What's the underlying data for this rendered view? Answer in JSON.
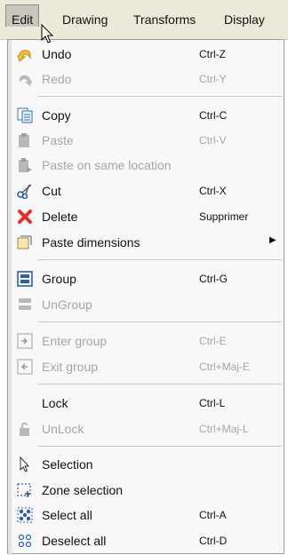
{
  "menubar": {
    "edit": "Edit",
    "drawing": "Drawing",
    "transforms": "Transforms",
    "display": "Display"
  },
  "menu": {
    "undo": {
      "label": "Undo",
      "shortcut": "Ctrl-Z"
    },
    "redo": {
      "label": "Redo",
      "shortcut": "Ctrl-Y"
    },
    "copy": {
      "label": "Copy",
      "shortcut": "Ctrl-C"
    },
    "paste": {
      "label": "Paste",
      "shortcut": "Ctrl-V"
    },
    "paste_same": {
      "label": "Paste on same location"
    },
    "cut": {
      "label": "Cut",
      "shortcut": "Ctrl-X"
    },
    "delete": {
      "label": "Delete",
      "shortcut": "Supprimer"
    },
    "paste_dimensions": {
      "label": "Paste dimensions"
    },
    "group": {
      "label": "Group",
      "shortcut": "Ctrl-G"
    },
    "ungroup": {
      "label": "UnGroup"
    },
    "enter_group": {
      "label": "Enter group",
      "shortcut": "Ctrl-E"
    },
    "exit_group": {
      "label": "Exit group",
      "shortcut": "Ctrl+Maj-E"
    },
    "lock": {
      "label": "Lock",
      "shortcut": "Ctrl-L"
    },
    "unlock": {
      "label": "UnLock",
      "shortcut": "Ctrl+Maj-L"
    },
    "selection": {
      "label": "Selection"
    },
    "zone_selection": {
      "label": "Zone selection"
    },
    "select_all": {
      "label": "Select all",
      "shortcut": "Ctrl-A"
    },
    "deselect_all": {
      "label": "Deselect all",
      "shortcut": "Ctrl-D"
    }
  }
}
